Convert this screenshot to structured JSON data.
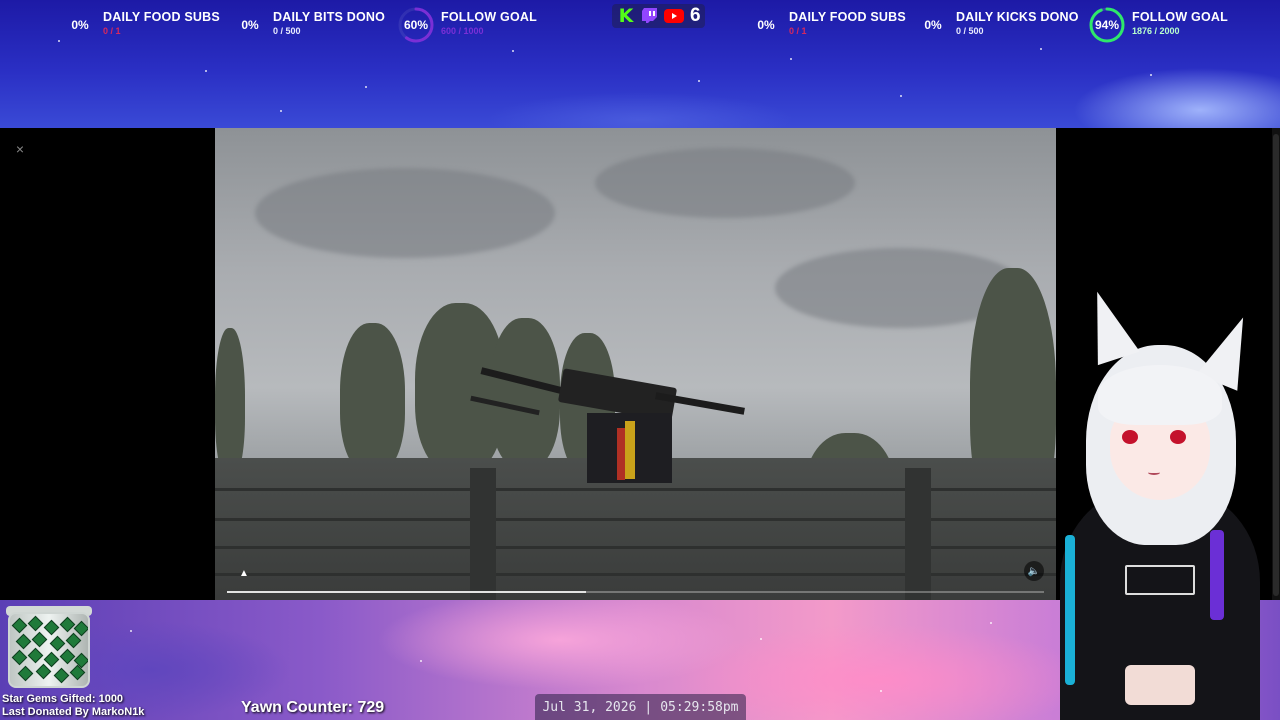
{
  "top_left_goals": [
    {
      "percent": "0%",
      "title": "DAILY FOOD SUBS",
      "progress": "0 / 1"
    },
    {
      "percent": "0%",
      "title": "DAILY BITS DONO",
      "progress": "0 / 500"
    },
    {
      "percent": "60%",
      "title": "FOLLOW GOAL",
      "progress": "600 / 1000"
    }
  ],
  "top_right_goals": [
    {
      "percent": "0%",
      "title": "DAILY FOOD SUBS",
      "progress": "0 / 1"
    },
    {
      "percent": "0%",
      "title": "DAILY KICKS DONO",
      "progress": "0 / 500"
    },
    {
      "percent": "94%",
      "title": "FOLLOW GOAL",
      "progress": "1876 / 2000"
    }
  ],
  "follow_goal_left_fraction": 0.6,
  "follow_goal_right_fraction": 0.94,
  "platforms": {
    "icons": [
      "kick-icon",
      "twitch-icon",
      "youtube-icon"
    ],
    "kick_glyph": "K",
    "count": "6"
  },
  "colors": {
    "kick": "#53fc18",
    "twitch": "#9146ff",
    "youtube": "#ff0000",
    "goal_ring_purple": "#7a2fd6",
    "goal_ring_green": "#2ee86a"
  },
  "video": {
    "close_glyph": "×",
    "mute_glyph": "🔈",
    "progress_fraction": 0.44
  },
  "bottom": {
    "star_gems": "Star Gems Gifted: 1000",
    "last_donated": "Last Donated By MarkoN1k",
    "yawn_counter": "Yawn Counter: 729",
    "date": "Jul 31, 2026",
    "separator": "|",
    "time": "05:29:58pm"
  }
}
